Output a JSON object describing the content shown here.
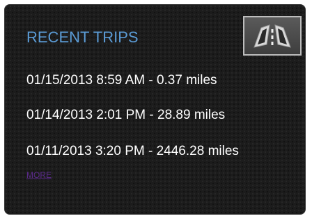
{
  "widget": {
    "title": "RECENT TRIPS",
    "map_icon": "road-split-map-icon",
    "trips": [
      {
        "label": "01/15/2013 8:59 AM - 0.37 miles"
      },
      {
        "label": "01/14/2013 2:01 PM - 28.89 miles"
      },
      {
        "label": "01/11/2013 3:20 PM - 2446.28 miles"
      }
    ],
    "more_label": "MORE"
  },
  "colors": {
    "panel_background": "#1c1c1c",
    "title": "#5b9bd5",
    "trip_text": "#ffffff",
    "more_link": "#5a2a8a"
  }
}
